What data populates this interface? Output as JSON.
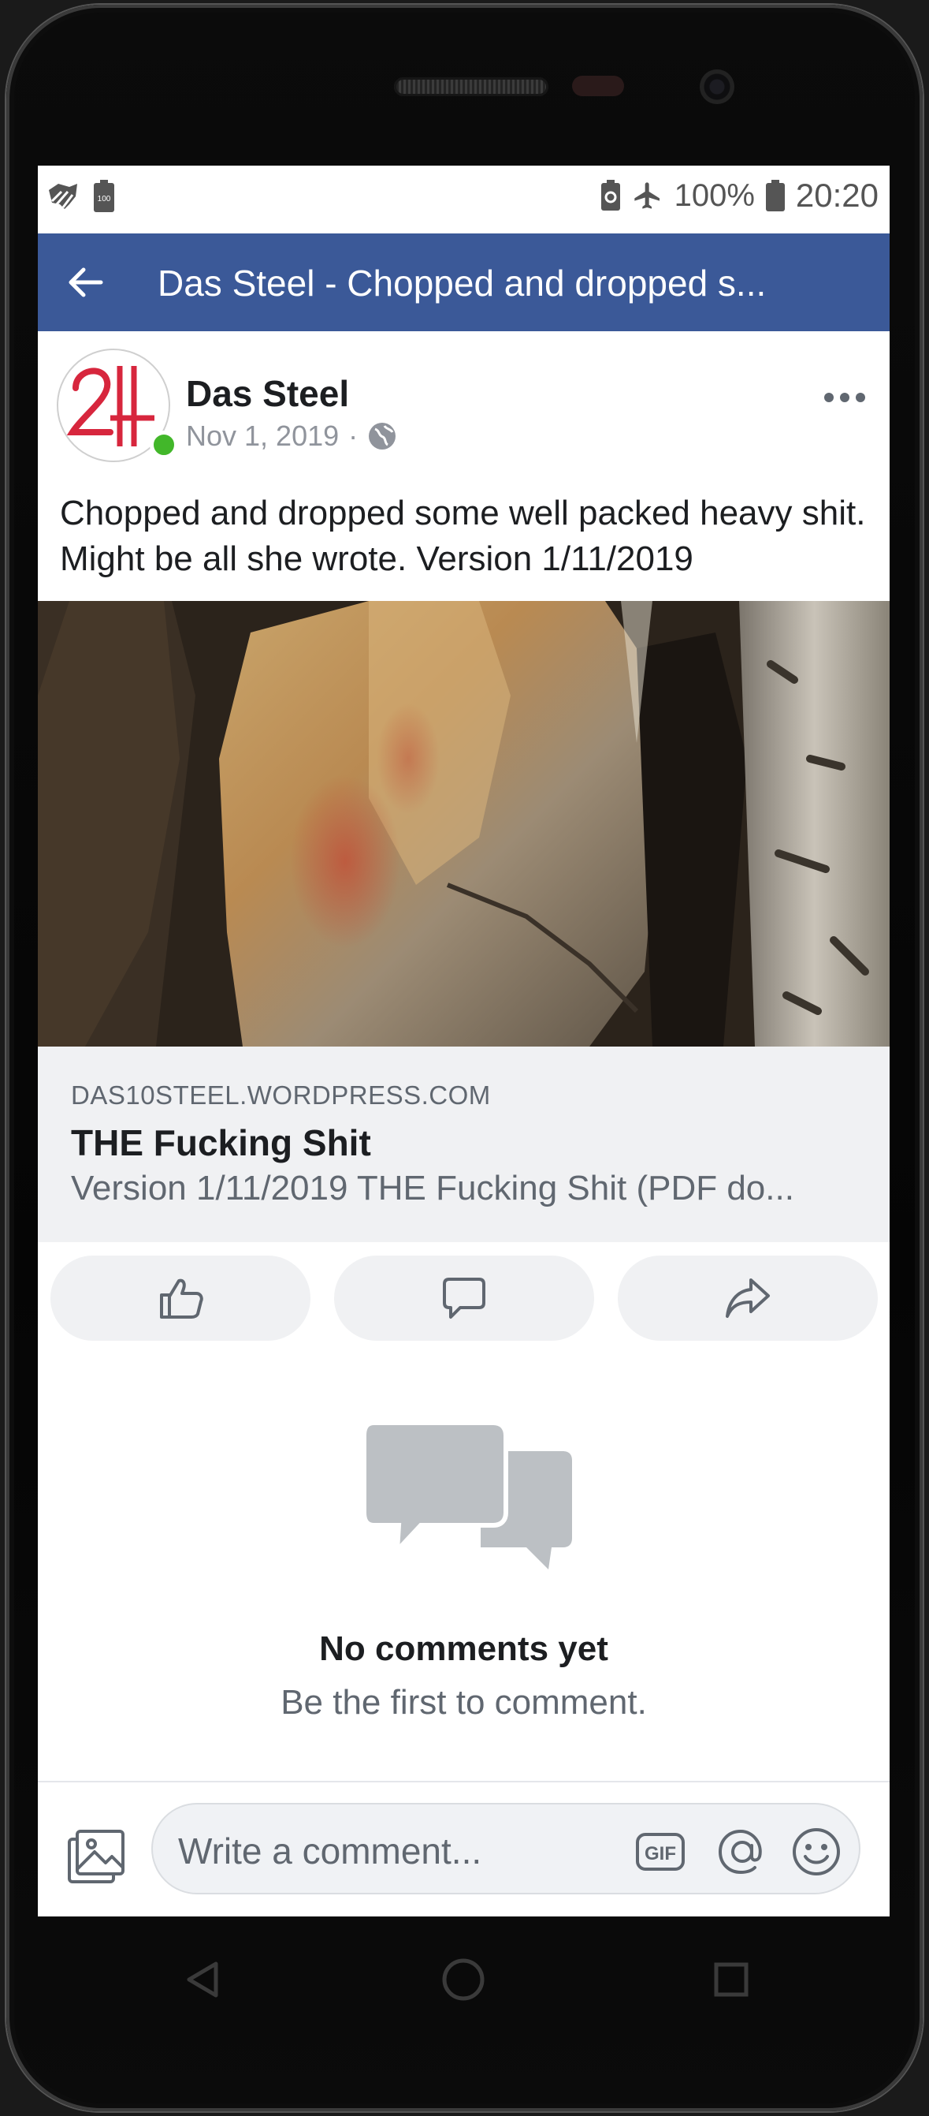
{
  "status_bar": {
    "battery_percent": "100%",
    "time": "20:20",
    "left_icons": [
      "weather-map-icon",
      "battery-100-icon"
    ],
    "right_icons": [
      "battery-saver-icon",
      "airplane-mode-icon",
      "battery-icon"
    ]
  },
  "app_bar": {
    "title": "Das Steel - Chopped and dropped s...",
    "background": "#3b5998"
  },
  "post": {
    "author": "Das Steel",
    "date": "Nov 1, 2019",
    "separator": "·",
    "text": "Chopped and dropped some well packed heavy shit. Might be all she wrote. Version 1/11/2019"
  },
  "link_preview": {
    "domain": "DAS10STEEL.WORDPRESS.COM",
    "title": "THE Fucking Shit",
    "description": "Version 1/11/2019 THE Fucking Shit (PDF do..."
  },
  "actions": {
    "like_icon": "thumbs-up-icon",
    "comment_icon": "comment-bubble-icon",
    "share_icon": "share-arrow-icon"
  },
  "comments": {
    "empty_title": "No comments yet",
    "empty_subtitle": "Be the first to comment."
  },
  "composer": {
    "placeholder": "Write a comment...",
    "gif_label": "GIF"
  }
}
